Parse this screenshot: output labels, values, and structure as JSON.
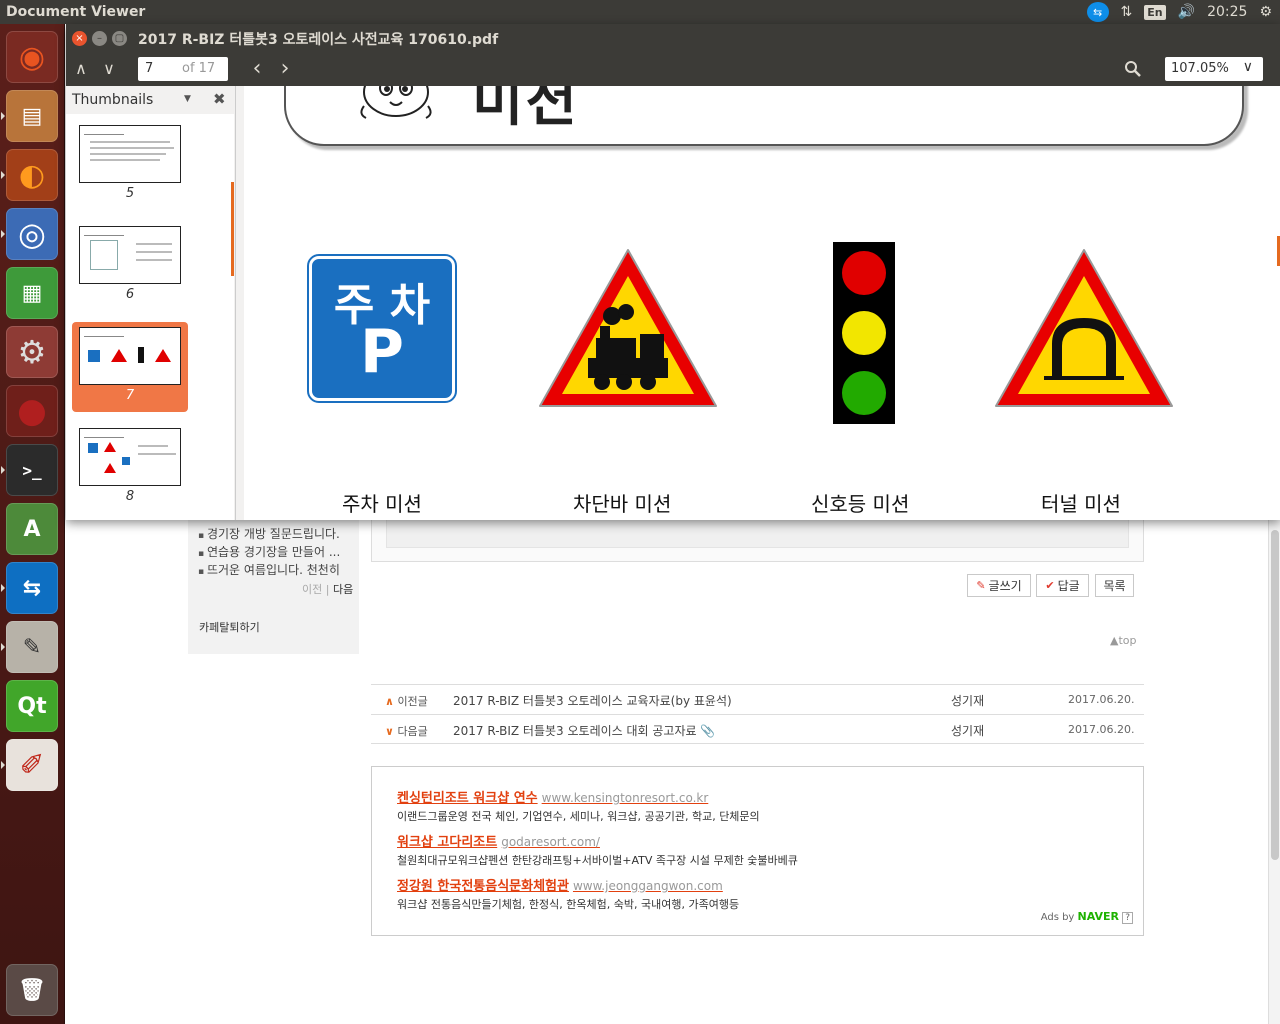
{
  "top_panel": {
    "app_name": "Document Viewer",
    "teamviewer_glyph": "⇆",
    "network_glyph": "⇅",
    "keyboard_layout": "En",
    "volume_glyph": "🔊",
    "clock": "20:25",
    "settings_glyph": "⚙"
  },
  "launcher": {
    "items": [
      {
        "name": "ubuntu-dash-icon",
        "glyph": "◉"
      },
      {
        "name": "files-icon",
        "glyph": "▤"
      },
      {
        "name": "firefox-icon",
        "glyph": "◐"
      },
      {
        "name": "chromium-icon",
        "glyph": "◎"
      },
      {
        "name": "libreoffice-calc-icon",
        "glyph": "▦"
      },
      {
        "name": "system-settings-icon",
        "glyph": "⚙"
      },
      {
        "name": "red-app-icon",
        "glyph": "●"
      },
      {
        "name": "terminal-icon",
        "glyph": ">_"
      },
      {
        "name": "software-updater-icon",
        "glyph": "A"
      },
      {
        "name": "teamviewer-icon",
        "glyph": "⇆"
      },
      {
        "name": "text-editor-icon",
        "glyph": "✎"
      },
      {
        "name": "qt-creator-icon",
        "glyph": "Qt"
      },
      {
        "name": "document-viewer-icon",
        "glyph": "✐"
      },
      {
        "name": "trash-icon",
        "glyph": "🗑"
      }
    ]
  },
  "window": {
    "title": "2017 R-BIZ 터틀봇3 오토레이스 사전교육 170610.pdf",
    "close_glyph": "×",
    "minimize_glyph": "–",
    "maximize_glyph": "▢"
  },
  "toolbar": {
    "prev_page_glyph": "∧",
    "next_page_glyph": "∨",
    "page_current": "7",
    "page_of": "of 17",
    "back_glyph": "‹",
    "forward_glyph": "›",
    "zoom": "107.05%",
    "zoom_arrow": "∨"
  },
  "thumbnails": {
    "label": "Thumbnails",
    "dropdown_glyph": "▼",
    "close_glyph": "✖",
    "pages": [
      {
        "num": "5",
        "selected": false
      },
      {
        "num": "6",
        "selected": false
      },
      {
        "num": "7",
        "selected": true
      },
      {
        "num": "8",
        "selected": false
      }
    ]
  },
  "slide": {
    "title": "미션",
    "captions": [
      "주차 미션",
      "차단바  미션",
      "신호등 미션",
      "터널 미션"
    ],
    "parking_sign": {
      "line1": "주 차",
      "line2": "P",
      "color": "#1a6fc0"
    },
    "traffic_light_colors": [
      "#e00000",
      "#f2e600",
      "#22aa00"
    ]
  },
  "webpage": {
    "side_posts": [
      "경기장 개방 질문드립니다.",
      "연습용 경기장을 만들어 ...",
      "뜨거운 여름입니다. 천천히"
    ],
    "side_prev": "이전",
    "side_next": "다음",
    "leave_cafe": "카페탈퇴하기",
    "buttons": {
      "write": "글쓰기",
      "reply": "답글",
      "list": "목록"
    },
    "top_link": "top",
    "nav_rows": [
      {
        "dir": "이전글",
        "arrow": "∧",
        "subject": "2017 R-BIZ 터틀봇3 오토레이스 교육자료(by 표윤석)",
        "author": "성기재",
        "date": "2017.06.20.",
        "attachment": ""
      },
      {
        "dir": "다음글",
        "arrow": "∨",
        "subject": "2017 R-BIZ 터틀봇3 오토레이스 대회 공고자료",
        "author": "성기재",
        "date": "2017.06.20.",
        "attachment": "📎"
      }
    ],
    "ads": [
      {
        "title": "켄싱턴리조트 워크샵 연수",
        "url": "www.kensingtonresort.co.kr",
        "desc": "이랜드그룹운영 전국 체인, 기업연수, 세미나, 워크샵, 공공기관, 학교, 단체문의"
      },
      {
        "title": "워크샵 고다리조트",
        "url": "godaresort.com/",
        "desc": "철원최대규모워크샵펜션 한탄강래프팅+서바이벌+ATV 족구장 시설 무제한 숯불바베큐"
      },
      {
        "title": "정강원 한국전통음식문화체험관",
        "url": "www.jeonggangwon.com",
        "desc": "워크샵 전통음식만들기체험, 한정식, 한옥체험, 숙박, 국내여행, 가족여행등"
      }
    ],
    "ads_by": "Ads by",
    "naver": "NAVER",
    "help": "?"
  }
}
